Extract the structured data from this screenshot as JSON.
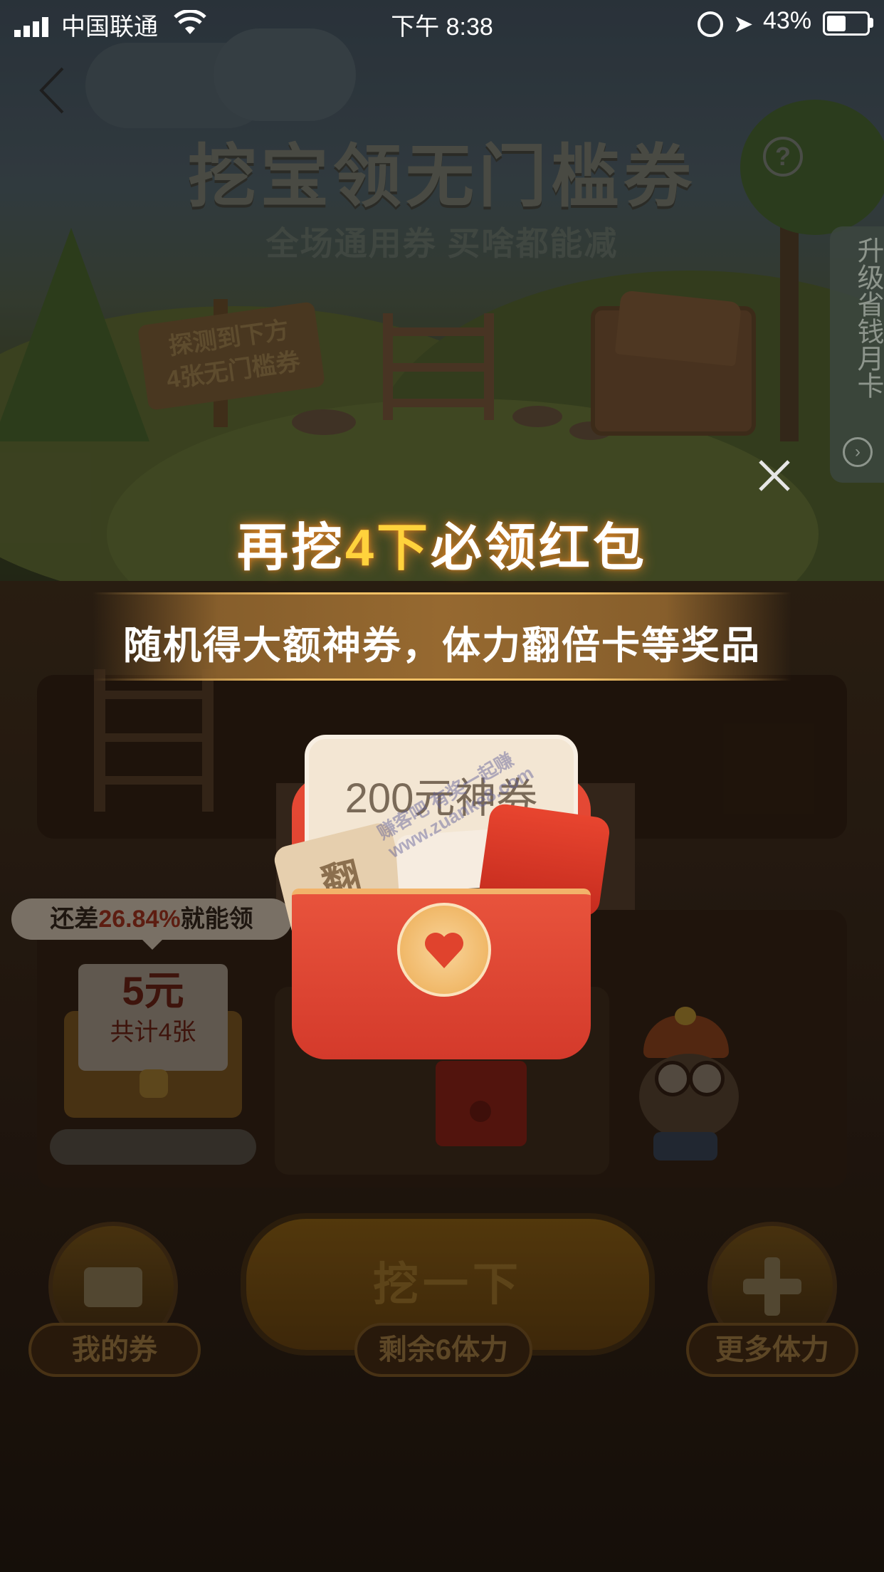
{
  "status_bar": {
    "carrier": "中国联通",
    "time": "下午 8:38",
    "battery_percent": "43%",
    "battery_level": 0.43
  },
  "header": {
    "title": "挖宝领无门槛券",
    "subtitle": "全场通用券 买啥都能减",
    "sign_text": "探测到下方\n4张无门槛券"
  },
  "side_tab": {
    "label": "升级省钱月卡"
  },
  "popup": {
    "title_prefix": "再挖",
    "title_highlight": "4下",
    "title_suffix": "必领红包",
    "banner": "随机得大额神券，体力翻倍卡等奖品",
    "coupon_main": "200元神券",
    "coupon_side": "翻倍",
    "coupon_small": "5元"
  },
  "watermark": "赚客吧 有奖一起赚 www.zuanke8.com",
  "progress": {
    "prefix": "还差",
    "value": "26.84%",
    "suffix": "就能领"
  },
  "treasure_card": {
    "amount": "5元",
    "count": "共计4张"
  },
  "controls": {
    "my_coupons": "我的券",
    "dig": "挖一下",
    "stamina_left": "剩余6体力",
    "more_stamina": "更多体力"
  },
  "colors": {
    "accent_gold": "#ffd23c",
    "red_packet": "#e0432d",
    "progress_red": "#c0392b"
  }
}
